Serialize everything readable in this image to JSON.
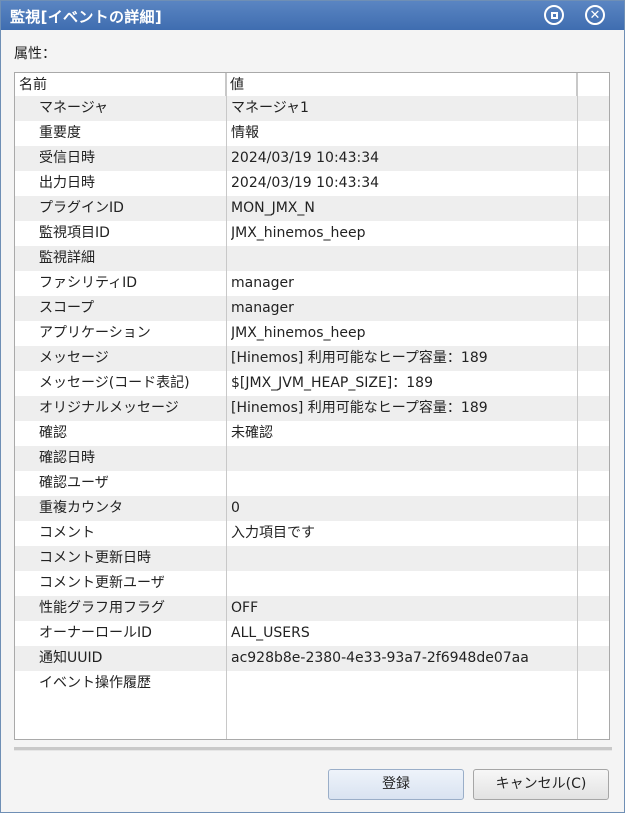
{
  "window": {
    "title": "監視[イベントの詳細]",
    "maximize_icon": "maximize-icon",
    "close_icon": "close-icon",
    "close_glyph": "✕"
  },
  "attributes_label": "属性：",
  "table": {
    "columns": [
      "名前",
      "値"
    ],
    "rows": [
      {
        "name": "マネージャ",
        "value": "マネージャ1"
      },
      {
        "name": "重要度",
        "value": "情報"
      },
      {
        "name": "受信日時",
        "value": "2024/03/19 10:43:34"
      },
      {
        "name": "出力日時",
        "value": "2024/03/19 10:43:34"
      },
      {
        "name": "プラグインID",
        "value": "MON_JMX_N"
      },
      {
        "name": "監視項目ID",
        "value": "JMX_hinemos_heep"
      },
      {
        "name": "監視詳細",
        "value": ""
      },
      {
        "name": "ファシリティID",
        "value": "manager"
      },
      {
        "name": "スコープ",
        "value": "manager"
      },
      {
        "name": "アプリケーション",
        "value": "JMX_hinemos_heep"
      },
      {
        "name": "メッセージ",
        "value": "[Hinemos] 利用可能なヒープ容量：189"
      },
      {
        "name": "メッセージ(コード表記)",
        "value": "$[JMX_JVM_HEAP_SIZE]：189"
      },
      {
        "name": "オリジナルメッセージ",
        "value": "[Hinemos] 利用可能なヒープ容量：189"
      },
      {
        "name": "確認",
        "value": "未確認"
      },
      {
        "name": "確認日時",
        "value": ""
      },
      {
        "name": "確認ユーザ",
        "value": ""
      },
      {
        "name": "重複カウンタ",
        "value": "0"
      },
      {
        "name": "コメント",
        "value": "入力項目です"
      },
      {
        "name": "コメント更新日時",
        "value": ""
      },
      {
        "name": "コメント更新ユーザ",
        "value": ""
      },
      {
        "name": "性能グラフ用フラグ",
        "value": "OFF"
      },
      {
        "name": "オーナーロールID",
        "value": "ALL_USERS"
      },
      {
        "name": "通知UUID",
        "value": "ac928b8e-2380-4e33-93a7-2f6948de07aa"
      },
      {
        "name": "イベント操作履歴",
        "value": ""
      }
    ]
  },
  "buttons": {
    "register": "登録",
    "cancel": "キャンセル(C)"
  },
  "colors": {
    "titlebar": "#4a78b8",
    "row_alt": "#eeeeee",
    "window_bg": "#f4f4f4"
  }
}
